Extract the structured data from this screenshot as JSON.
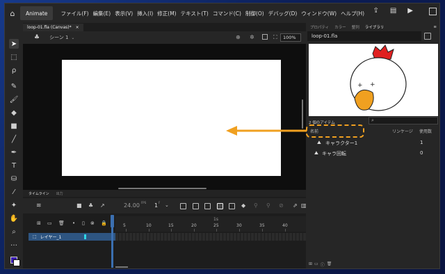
{
  "app": {
    "title": "Animate"
  },
  "menu": [
    "ファイル(F)",
    "編集(E)",
    "表示(V)",
    "挿入(I)",
    "修正(M)",
    "テキスト(T)",
    "コマンド(C)",
    "制御(O)",
    "デバッグ(D)",
    "ウィンドウ(W)",
    "ヘルプ(H)"
  ],
  "doc_tab": {
    "label": "loop-01.fla (Canvas)*",
    "close": "×"
  },
  "scene": {
    "label": "シーン 1",
    "zoom": "100%"
  },
  "timeline": {
    "tabs": [
      "タイムライン",
      "出力"
    ],
    "fps": "24.00",
    "fps_unit": "FPS",
    "frame": "1",
    "frame_unit": "F",
    "ruler": [
      "1s",
      "5",
      "10",
      "15",
      "20",
      "25",
      "30",
      "35",
      "40"
    ],
    "layer": "レイヤー_1"
  },
  "right": {
    "tabs": [
      "プロパティ",
      "カラー",
      "整列",
      "ライブラリ"
    ],
    "doc": "loop-01.fla",
    "item_count": "2 個のアイテム",
    "col_name": "名前",
    "col_linkage": "リンケージ",
    "col_use": "使用数",
    "items": [
      {
        "name": "キャラクター1",
        "count": "1"
      },
      {
        "name": "キャラ回転",
        "count": "0"
      }
    ]
  },
  "annotation": {
    "color": "#f0a020"
  }
}
